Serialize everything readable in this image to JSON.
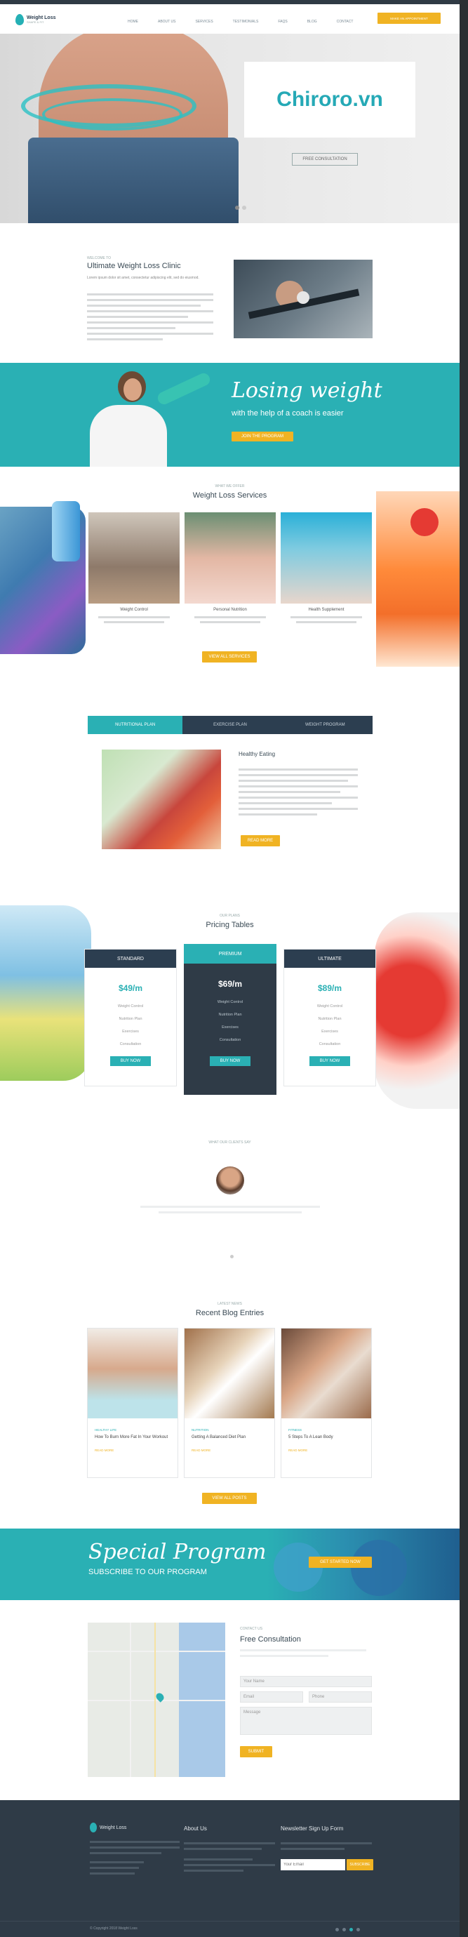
{
  "nav": {
    "logo_name": "Weight Loss",
    "logo_sub": "SHAPE & FIT",
    "menu": [
      "HOME",
      "ABOUT US",
      "SERVICES",
      "TESTIMONIALS",
      "FAQS",
      "BLOG",
      "CONTACT"
    ],
    "cta": "MAKE AN APPOINTMENT"
  },
  "hero": {
    "watermark": "Chiroro.vn",
    "button": "FREE CONSULTATION"
  },
  "about": {
    "kicker": "WELCOME TO",
    "title": "Ultimate Weight Loss Clinic",
    "intro": "Lorem ipsum dolor sit amet, consectetur adipiscing elit, sed do eiusmod."
  },
  "promo": {
    "headline": "Losing weight",
    "subline": "with the help of a coach is easier",
    "button": "JOIN THE PROGRAM"
  },
  "services": {
    "kicker": "WHAT WE OFFER",
    "title": "Weight Loss Services",
    "items": [
      {
        "label": "Weight Control"
      },
      {
        "label": "Personal Nutrition"
      },
      {
        "label": "Health Supplement"
      }
    ],
    "button": "VIEW ALL SERVICES"
  },
  "tabs": {
    "labels": [
      "NUTRITIONAL PLAN",
      "EXERCISE PLAN",
      "WEIGHT PROGRAM"
    ],
    "active": 0,
    "panel_title": "Healthy Eating",
    "button": "READ MORE"
  },
  "pricing": {
    "kicker": "OUR PLANS",
    "title": "Pricing Tables",
    "plans": [
      {
        "name": "STANDARD",
        "price": "$49/m",
        "features": [
          "Weight Control",
          "Nutrition Plan",
          "Exercises",
          "Consultation"
        ],
        "button": "BUY NOW"
      },
      {
        "name": "PREMIUM",
        "price": "$69/m",
        "features": [
          "Weight Control",
          "Nutrition Plan",
          "Exercises",
          "Consultation"
        ],
        "button": "BUY NOW"
      },
      {
        "name": "ULTIMATE",
        "price": "$89/m",
        "features": [
          "Weight Control",
          "Nutrition Plan",
          "Exercises",
          "Consultation"
        ],
        "button": "BUY NOW"
      }
    ]
  },
  "testimonials": {
    "kicker": "WHAT OUR CLIENTS SAY"
  },
  "blog": {
    "kicker": "LATEST NEWS",
    "title": "Recent Blog Entries",
    "posts": [
      {
        "category": "HEALTHY LIFE",
        "title": "How To Burn More Fat In Your Workout",
        "meta": "READ MORE"
      },
      {
        "category": "NUTRITION",
        "title": "Getting A Balanced Diet Plan",
        "meta": "READ MORE"
      },
      {
        "category": "FITNESS",
        "title": "5 Steps To A Lean Body",
        "meta": "READ MORE"
      }
    ],
    "button": "VIEW ALL POSTS"
  },
  "special": {
    "headline": "Special Program",
    "subline": "SUBSCRIBE TO OUR PROGRAM",
    "button": "GET STARTED NOW"
  },
  "consult": {
    "kicker": "CONTACT US",
    "title": "Free Consultation",
    "fields": [
      "Your Name",
      "Email",
      "Phone",
      "Message"
    ],
    "button": "SUBMIT"
  },
  "footer": {
    "logo_name": "Weight Loss",
    "about_head": "About Us",
    "news_head": "Newsletter Sign Up Form",
    "news_placeholder": "Your Email",
    "news_button": "SUBSCRIBE",
    "copyright": "© Copyright 2018 Weight Loss"
  },
  "colors": {
    "teal": "#2ab0b4",
    "yellow": "#f0b323",
    "dark": "#2f3b47"
  }
}
